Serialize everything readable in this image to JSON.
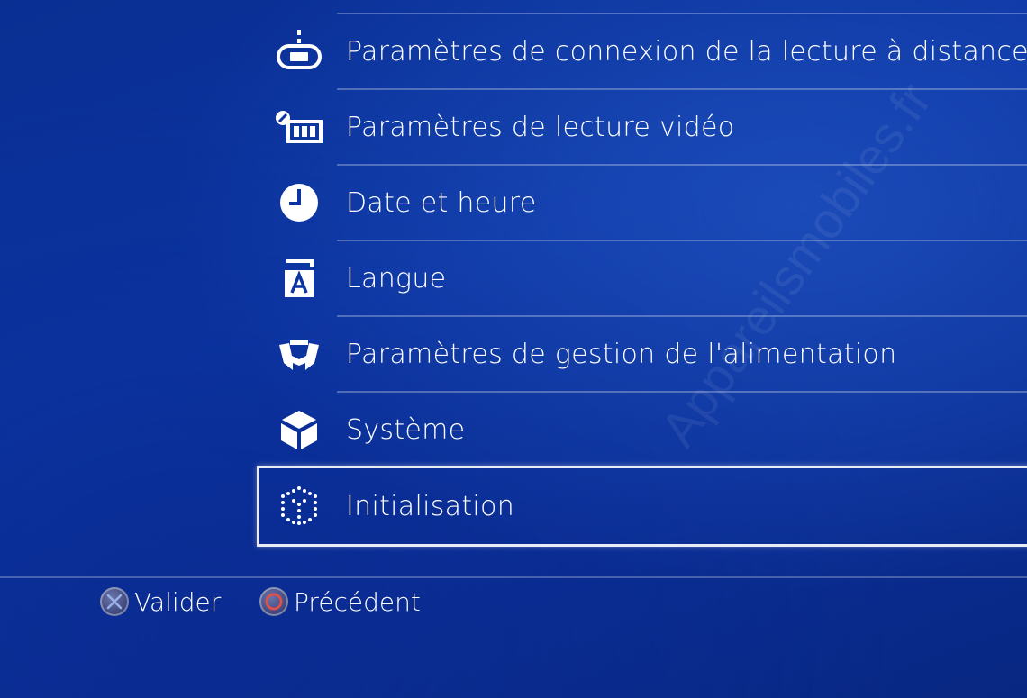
{
  "settings_menu": {
    "items": [
      {
        "label": "Paramètres de connexion de la lecture à distance",
        "icon": "remote-play-icon"
      },
      {
        "label": "Paramètres de lecture vidéo",
        "icon": "video-playback-icon"
      },
      {
        "label": "Date et heure",
        "icon": "clock-icon"
      },
      {
        "label": "Langue",
        "icon": "language-icon"
      },
      {
        "label": "Paramètres de gestion de l'alimentation",
        "icon": "power-save-icon"
      },
      {
        "label": "Système",
        "icon": "system-cube-icon"
      },
      {
        "label": "Initialisation",
        "icon": "initialization-dotted-cube-icon",
        "selected": true
      }
    ]
  },
  "footer": {
    "confirm": {
      "label": "Valider",
      "icon": "cross-button-icon"
    },
    "back": {
      "label": "Précédent",
      "icon": "circle-button-icon"
    }
  },
  "watermark": "Appareilsmobiles.fr",
  "colors": {
    "background": "#0b34a2",
    "text": "#ffffff",
    "circle_button": "#e0504a",
    "cross_button": "#9ab0e8"
  }
}
